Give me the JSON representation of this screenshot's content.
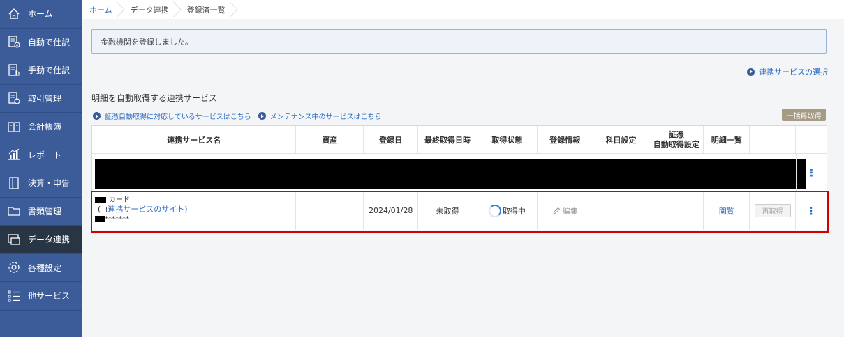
{
  "sidebar": {
    "items": [
      {
        "label": "ホーム",
        "icon": "home-icon"
      },
      {
        "label": "自動で仕訳",
        "icon": "auto-journal-icon"
      },
      {
        "label": "手動で仕訳",
        "icon": "manual-journal-icon"
      },
      {
        "label": "取引管理",
        "icon": "transaction-icon"
      },
      {
        "label": "会計帳簿",
        "icon": "ledger-icon"
      },
      {
        "label": "レポート",
        "icon": "report-icon"
      },
      {
        "label": "決算・申告",
        "icon": "settlement-icon"
      },
      {
        "label": "書類管理",
        "icon": "folder-icon"
      },
      {
        "label": "データ連携",
        "icon": "data-link-icon",
        "active": true
      },
      {
        "label": "各種設定",
        "icon": "gear-icon"
      },
      {
        "label": "他サービス",
        "icon": "list-icon"
      }
    ]
  },
  "breadcrumb": [
    "ホーム",
    "データ連携",
    "登録済一覧"
  ],
  "notice": "金融機関を登録しました。",
  "select_service_link": "連携サービスの選択",
  "section_title": "明細を自動取得する連携サービス",
  "sub_links": [
    "証憑自動取得に対応しているサービスはこちら",
    "メンテナンス中のサービスはこちら"
  ],
  "bulk_refetch_button": "一括再取得",
  "table": {
    "headers": [
      "連携サービス名",
      "資産",
      "登録日",
      "最終取得日時",
      "取得状態",
      "登録情報",
      "科目設定",
      "証憑\n自動取得設定",
      "明細一覧",
      "",
      ""
    ],
    "row": {
      "name_suffix": "カード",
      "site_link": "連携サービスのサイト",
      "account_mask": "*******",
      "asset": "",
      "registered_date": "2024/01/28",
      "last_fetched": "未取得",
      "status": "取得中",
      "edit_label": "編集",
      "subject_setting": "",
      "voucher_setting": "",
      "view_label": "閲覧",
      "refetch_label": "再取得"
    }
  },
  "colors": {
    "sidebar": "#3b5c98",
    "sidebar_active": "#283545",
    "link": "#2a6cc4",
    "highlight": "#d40000"
  }
}
